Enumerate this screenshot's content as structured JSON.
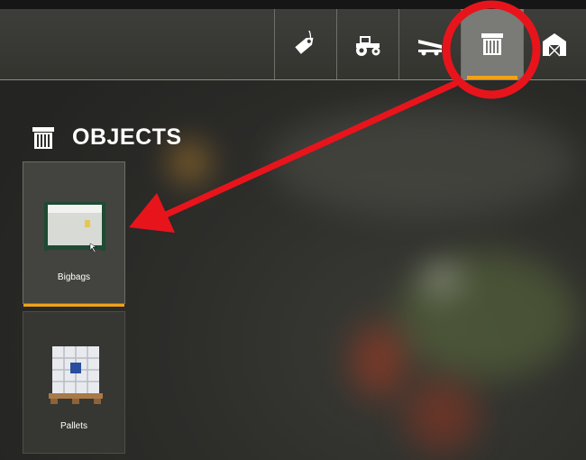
{
  "header": {
    "tabs": [
      {
        "icon": "price-tag-icon",
        "active": false
      },
      {
        "icon": "tractor-icon",
        "active": false
      },
      {
        "icon": "trailer-icon",
        "active": false
      },
      {
        "icon": "crate-icon",
        "active": true
      },
      {
        "icon": "barn-icon",
        "active": false
      }
    ]
  },
  "section": {
    "icon": "crate-icon",
    "title": "OBJECTS"
  },
  "items": [
    {
      "label": "Bigbags",
      "selected": true,
      "thumbnail": "bigbag-icon"
    },
    {
      "label": "Pallets",
      "selected": false,
      "thumbnail": "pallet-tank-icon"
    }
  ],
  "colors": {
    "accent": "#f0a21a",
    "annotation_red": "#e8141c",
    "active_tab": "#7a7a76"
  }
}
